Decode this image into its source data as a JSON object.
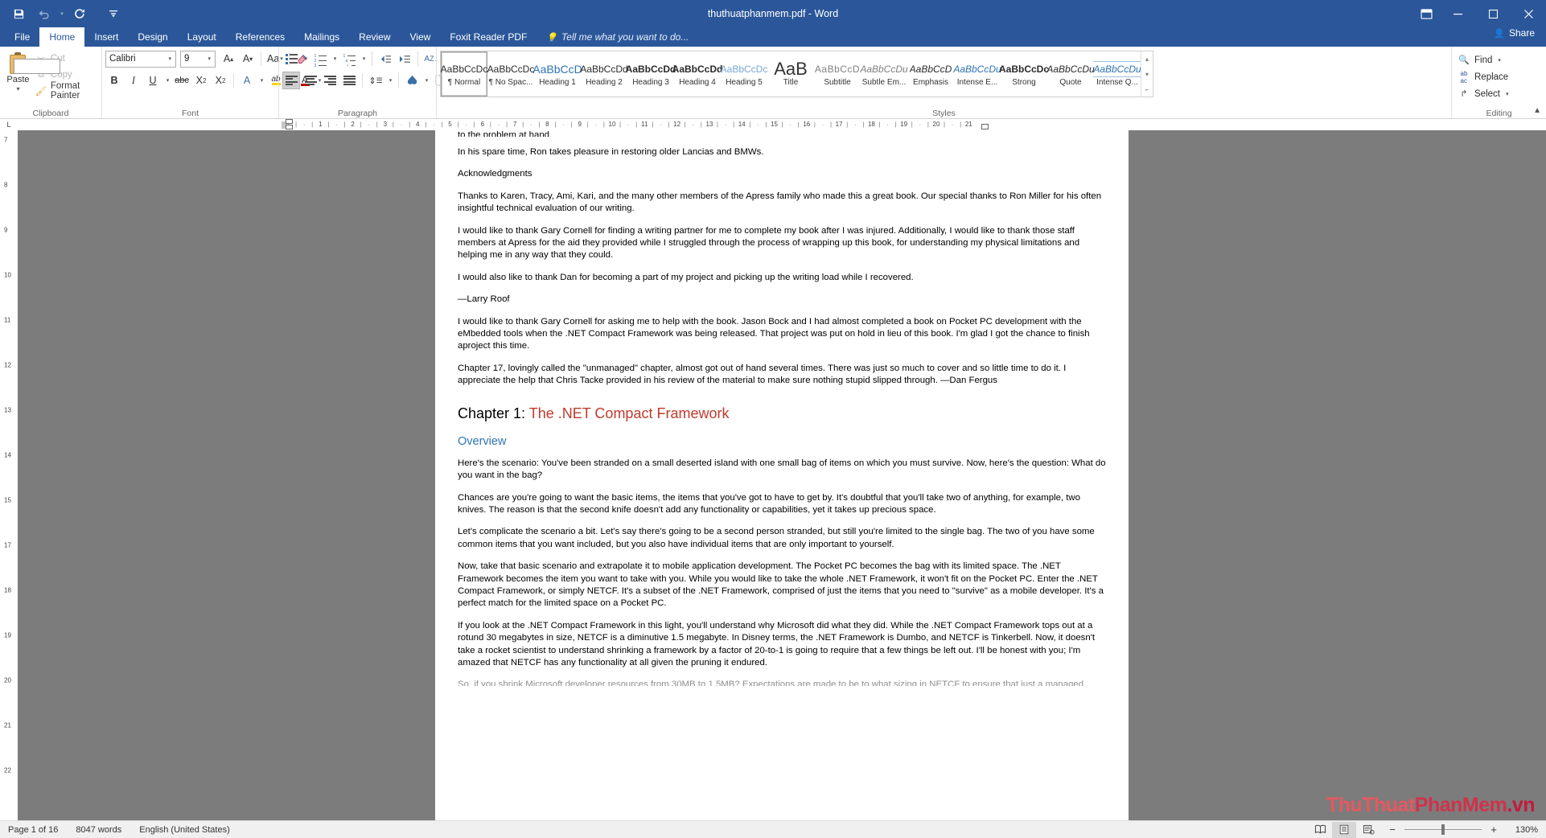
{
  "window": {
    "title": "thuthuatphanmem.pdf - Word",
    "quick_access": [
      {
        "name": "save-icon",
        "glyph": "💾"
      },
      {
        "name": "undo-icon",
        "glyph": "↶"
      },
      {
        "name": "undo-dropdown-icon",
        "glyph": "▾"
      },
      {
        "name": "redo-icon",
        "glyph": "↻"
      },
      {
        "name": "customize-qat-icon",
        "glyph": "≡"
      }
    ],
    "ribbon_display_options": "□",
    "minimize": "─",
    "restore": "❐",
    "close": "✕",
    "share_label": "Share",
    "share_icon": "👤"
  },
  "tabs": [
    {
      "label": "File",
      "active": false
    },
    {
      "label": "Home",
      "active": true
    },
    {
      "label": "Insert",
      "active": false
    },
    {
      "label": "Design",
      "active": false
    },
    {
      "label": "Layout",
      "active": false
    },
    {
      "label": "References",
      "active": false
    },
    {
      "label": "Mailings",
      "active": false
    },
    {
      "label": "Review",
      "active": false
    },
    {
      "label": "View",
      "active": false
    },
    {
      "label": "Foxit Reader PDF",
      "active": false
    }
  ],
  "tell_me": {
    "label": "Tell me what you want to do...",
    "icon": "💡"
  },
  "ribbon": {
    "clipboard": {
      "label": "Clipboard",
      "paste_label": "Paste",
      "commands": [
        {
          "label": "Cut",
          "icon": "✂",
          "enabled": false
        },
        {
          "label": "Copy",
          "icon": "⧉",
          "enabled": false
        },
        {
          "label": "Format Painter",
          "icon": "🖌",
          "enabled": true
        }
      ]
    },
    "font": {
      "label": "Font",
      "font_name": "Calibri",
      "font_size": "9",
      "grow_font": "A▴",
      "shrink_font": "A▾",
      "change_case": "Aa",
      "clear_formatting": "✐",
      "bold": "B",
      "italic": "I",
      "underline": "U",
      "strikethrough": "abc",
      "subscript": "X₂",
      "superscript": "X²",
      "text_effects": "A",
      "highlight": "ab",
      "font_color": "A"
    },
    "paragraph": {
      "label": "Paragraph",
      "bullets": "bullet-list-icon",
      "numbering": "numbered-list-icon",
      "multilevel": "multilevel-list-icon",
      "decrease_indent": "←|",
      "increase_indent": "|→",
      "sort": "A↓",
      "show_marks": "¶",
      "align_left": "align-left-icon",
      "align_center": "align-center-icon",
      "align_right": "align-right-icon",
      "justify": "justify-icon",
      "line_spacing": "↕",
      "shading": "shading-icon",
      "borders": "borders-icon"
    },
    "styles": {
      "label": "Styles",
      "items": [
        {
          "sample": "AaBbCcDc",
          "name": "¶ Normal",
          "selected": true
        },
        {
          "sample": "AaBbCcDc",
          "name": "¶ No Spac...",
          "selected": false
        },
        {
          "sample": "AaBbCcD",
          "name": "Heading 1",
          "selected": false
        },
        {
          "sample": "AaBbCcDd",
          "name": "Heading 2",
          "selected": false
        },
        {
          "sample": "AaBbCcDd",
          "name": "Heading 3",
          "selected": false
        },
        {
          "sample": "AaBbCcDd",
          "name": "Heading 4",
          "selected": false
        },
        {
          "sample": "AaBbCcDc",
          "name": "Heading 5",
          "selected": false
        },
        {
          "sample": "AaB",
          "name": "Title",
          "selected": false
        },
        {
          "sample": "AaBbCcD",
          "name": "Subtitle",
          "selected": false
        },
        {
          "sample": "AaBbCcDu",
          "name": "Subtle Em...",
          "selected": false
        },
        {
          "sample": "AaBbCcD",
          "name": "Emphasis",
          "selected": false
        },
        {
          "sample": "AaBbCcDu",
          "name": "Intense E...",
          "selected": false
        },
        {
          "sample": "AaBbCcDc",
          "name": "Strong",
          "selected": false
        },
        {
          "sample": "AaBbCcDu",
          "name": "Quote",
          "selected": false
        },
        {
          "sample": "AaBbCcDu",
          "name": "Intense Q...",
          "selected": false
        }
      ],
      "scroll_up": "▴",
      "scroll_down": "▾",
      "more": "≡"
    },
    "editing": {
      "label": "Editing",
      "find_label": "Find",
      "find_icon": "🔍",
      "replace_label": "Replace",
      "replace_icon": "ab↵ac",
      "select_label": "Select",
      "select_icon": "↱"
    }
  },
  "ruler": {
    "horizontal_ticks": [
      "1",
      "2",
      "3",
      "4",
      "5",
      "6",
      "7",
      "8",
      "9",
      "10",
      "11",
      "12",
      "13",
      "14",
      "15",
      "16",
      "17",
      "18",
      "19",
      "20",
      "21"
    ],
    "vertical_ticks": [
      "7",
      "8",
      "9",
      "10",
      "11",
      "12",
      "13",
      "14",
      "15",
      "17",
      "18",
      "19",
      "20",
      "21",
      "22"
    ]
  },
  "document": {
    "blocks": [
      {
        "type": "p-cut",
        "text": "to the problem at hand."
      },
      {
        "type": "p",
        "text": "In his spare time, Ron takes pleasure in restoring older Lancias and BMWs."
      },
      {
        "type": "p",
        "text": "Acknowledgments"
      },
      {
        "type": "p",
        "text": "Thanks to Karen, Tracy, Ami, Kari, and the many other members of the Apress family who made this a great book. Our special thanks to Ron Miller for his often insightful technical evaluation of our writing."
      },
      {
        "type": "p",
        "text": "I would like to thank Gary Cornell for finding a writing partner for me to complete my book after I was injured. Additionally, I would like to thank those staff members at Apress for the aid they provided while I struggled through the process of wrapping up this book, for understanding my physical limitations and helping me in any way that they could."
      },
      {
        "type": "p",
        "text": "I would also like to thank Dan for becoming a part of my project and picking up the writing load while I recovered."
      },
      {
        "type": "p",
        "text": "—Larry Roof"
      },
      {
        "type": "p",
        "text": "I would like to thank Gary Cornell for asking me to help with the book. Jason Bock and I had almost completed a book on Pocket PC development with the eMbedded tools when the .NET Compact Framework was being released. That project was put on hold in lieu of this book. I'm glad I got the chance to finish aproject this time."
      },
      {
        "type": "p",
        "text": "Chapter 17, lovingly called the \"unmanaged\" chapter, almost got out of hand several times. There was just so much to cover and so little time to do it. I appreciate the help that Chris Tacke provided in his review of the material to make sure nothing stupid slipped through. —Dan Fergus"
      },
      {
        "type": "h-chapter",
        "text": "Chapter 1: ",
        "accent": "The .NET Compact Framework"
      },
      {
        "type": "h-overview",
        "text": "Overview"
      },
      {
        "type": "p",
        "text": "Here's the scenario: You've been stranded on a small deserted island with one small bag of items on which you must survive. Now, here's the question: What do you want in the bag?"
      },
      {
        "type": "p",
        "text": "Chances are you're going to want the basic items, the items that you've got to have to get by. It's doubtful that you'll take two of anything, for example, two knives. The reason is that the second knife doesn't add any functionality or capabilities, yet it takes up precious space."
      },
      {
        "type": "p",
        "text": "Let's complicate the scenario a bit. Let's say there's going to be a second person stranded, but still you're limited to the single bag. The two of you have some common items that you want included, but you also have individual items that are only important to yourself."
      },
      {
        "type": "p",
        "text": "Now, take that basic scenario and extrapolate it to mobile application development. The Pocket PC becomes the bag with its limited space. The .NET Framework becomes the item you want to take with you. While you would like to take the whole .NET Framework, it won't fit on the Pocket PC. Enter the .NET Compact Framework, or simply NETCF. It's a subset of the .NET Framework, comprised of just the items that you need to \"survive\" as a mobile developer. It's a perfect match for the limited space on a Pocket PC."
      },
      {
        "type": "p",
        "text": "If you look at the .NET Compact Framework in this light, you'll understand why Microsoft did what they did. While the .NET Compact Framework tops out at a rotund 30 megabytes in size, NETCF is a diminutive 1.5 megabyte. In Disney terms, the .NET Framework is Dumbo, and NETCF is Tinkerbell. Now, it doesn't take a rocket scientist to understand shrinking a framework by a factor of 20-to-1 is going to require that a few things be left out. I'll be honest with you; I'm amazed that NETCF has any functionality at all given the pruning it endured."
      },
      {
        "type": "p-cut-bottom",
        "text": "So, if you shrink Microsoft developer resources from 30MB to 1.5MB? Expectations are made to be to what sizing in NETCF to ensure that just a managed subset in what you want."
      }
    ]
  },
  "watermark": {
    "part1": "ThuThuat",
    "part2": "PhanMem",
    "part3": ".vn"
  },
  "status": {
    "page": "Page 1 of 16",
    "words": "8047 words",
    "language": "English (United States)",
    "views": [
      {
        "name": "read-mode-icon",
        "glyph": "📖",
        "active": false
      },
      {
        "name": "print-layout-icon",
        "glyph": "▤",
        "active": true
      },
      {
        "name": "web-layout-icon",
        "glyph": "☰",
        "active": false
      }
    ],
    "zoom_out": "−",
    "zoom_in": "+",
    "zoom_level": "130%"
  }
}
